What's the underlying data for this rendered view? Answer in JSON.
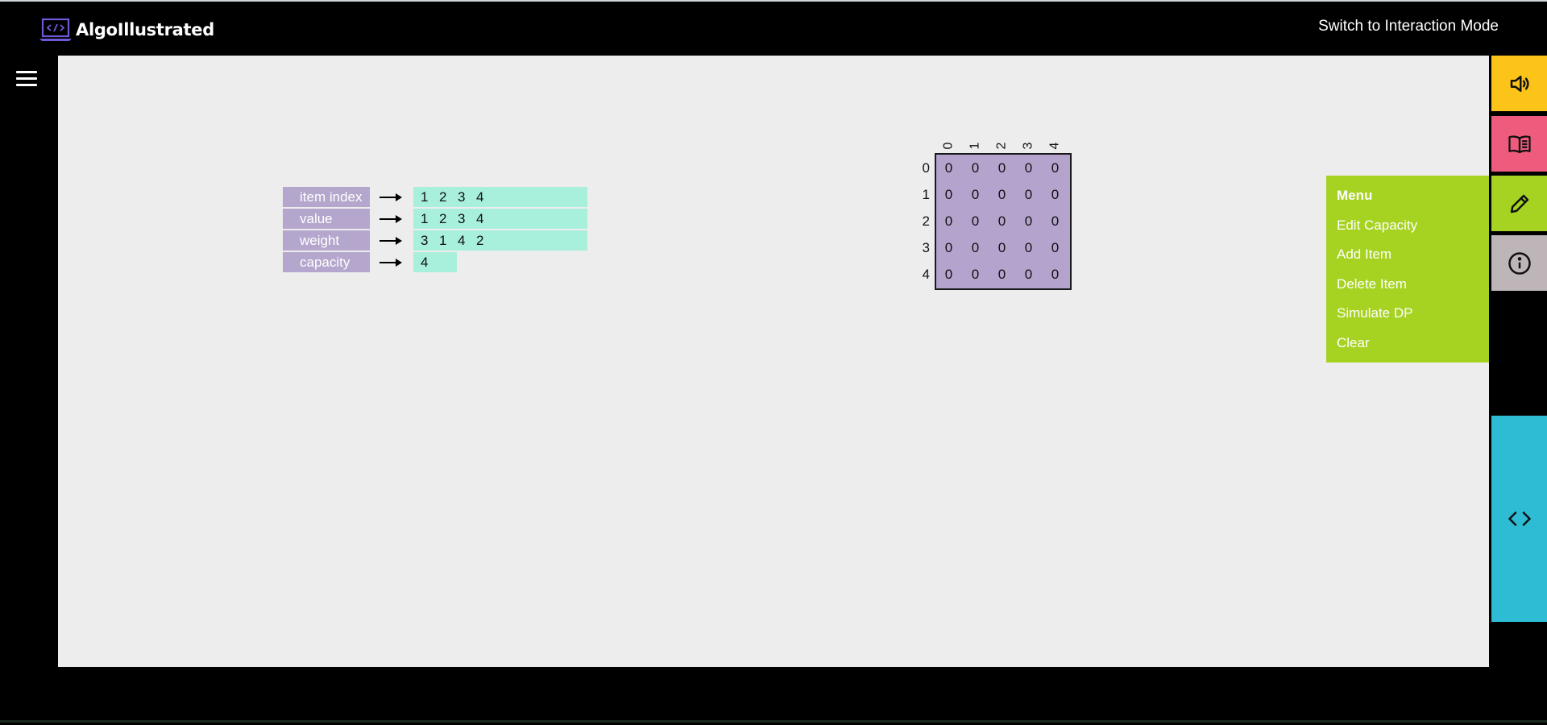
{
  "app": {
    "title": "AlgoIllustrated",
    "mode_link": "Switch to Interaction Mode"
  },
  "sidebar": {
    "icons": [
      "hamburger-icon"
    ],
    "buttons": [
      {
        "name": "sound",
        "icon": "speaker-icon",
        "color": "#fcc419"
      },
      {
        "name": "book",
        "icon": "book-icon",
        "color": "#ef5b7c"
      },
      {
        "name": "edit",
        "icon": "pencil-icon",
        "color": "#a6d321"
      },
      {
        "name": "info",
        "icon": "info-icon",
        "color": "#beb5b9"
      },
      {
        "name": "code",
        "icon": "code-icon",
        "color": "#2dbcd4"
      }
    ]
  },
  "menu": {
    "title": "Menu",
    "items": [
      "Edit Capacity",
      "Add Item",
      "Delete Item",
      "Simulate DP",
      "Clear"
    ]
  },
  "inputs": {
    "rows": [
      {
        "label": "item index",
        "values": [
          "1",
          "2",
          "3",
          "4"
        ]
      },
      {
        "label": "value",
        "values": [
          "1",
          "2",
          "3",
          "4"
        ]
      },
      {
        "label": "weight",
        "values": [
          "3",
          "1",
          "4",
          "2"
        ]
      },
      {
        "label": "capacity",
        "values": [
          "4"
        ]
      }
    ]
  },
  "dp_table": {
    "columns": [
      "0",
      "1",
      "2",
      "3",
      "4"
    ],
    "rows": [
      "0",
      "1",
      "2",
      "3",
      "4"
    ],
    "cells": [
      [
        "0",
        "0",
        "0",
        "0",
        "0"
      ],
      [
        "0",
        "0",
        "0",
        "0",
        "0"
      ],
      [
        "0",
        "0",
        "0",
        "0",
        "0"
      ],
      [
        "0",
        "0",
        "0",
        "0",
        "0"
      ],
      [
        "0",
        "0",
        "0",
        "0",
        "0"
      ]
    ]
  },
  "colors": {
    "label_bg": "#b4a6cc",
    "value_bg": "#a8efdc",
    "table_bg": "#b4a3cc",
    "canvas_bg": "#ededed"
  }
}
